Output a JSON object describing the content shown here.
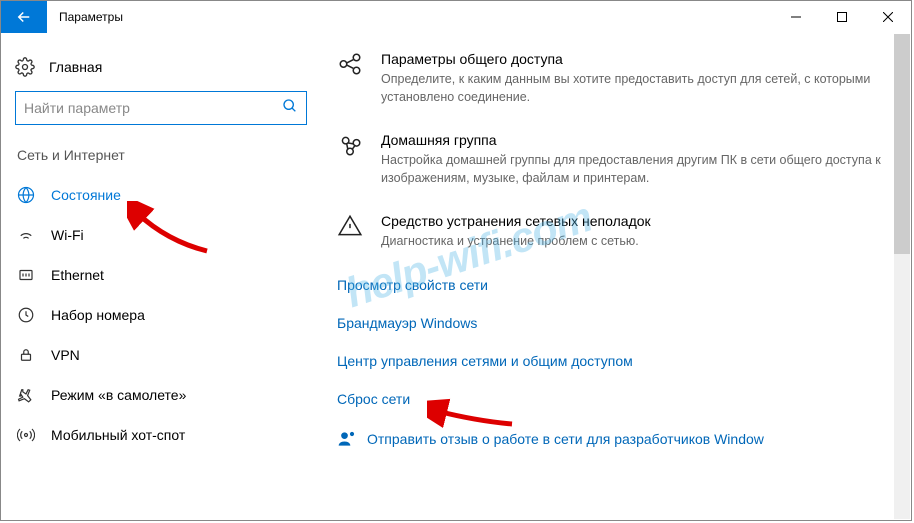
{
  "window": {
    "title": "Параметры"
  },
  "sidebar": {
    "home": "Главная",
    "search_placeholder": "Найти параметр",
    "section": "Сеть и Интернет",
    "items": [
      {
        "label": "Состояние",
        "icon": "globe-icon"
      },
      {
        "label": "Wi-Fi",
        "icon": "wifi-icon"
      },
      {
        "label": "Ethernet",
        "icon": "ethernet-icon"
      },
      {
        "label": "Набор номера",
        "icon": "dialup-icon"
      },
      {
        "label": "VPN",
        "icon": "vpn-icon"
      },
      {
        "label": "Режим «в самолете»",
        "icon": "airplane-icon"
      },
      {
        "label": "Мобильный хот-спот",
        "icon": "hotspot-icon"
      }
    ]
  },
  "content": {
    "options": [
      {
        "title": "Параметры общего доступа",
        "desc": "Определите, к каким данным вы хотите предоставить доступ для сетей, с которыми установлено соединение."
      },
      {
        "title": "Домашняя группа",
        "desc": "Настройка домашней группы для предоставления другим ПК в сети общего доступа к изображениям, музыке, файлам и принтерам."
      },
      {
        "title": "Средство устранения сетевых неполадок",
        "desc": "Диагностика и устранение проблем с сетью."
      }
    ],
    "links": [
      "Просмотр свойств сети",
      "Брандмауэр Windows",
      "Центр управления сетями и общим доступом",
      "Сброс сети"
    ],
    "feedback": "Отправить отзыв о работе в сети для разработчиков Window"
  },
  "watermark": "help-wifi.com"
}
